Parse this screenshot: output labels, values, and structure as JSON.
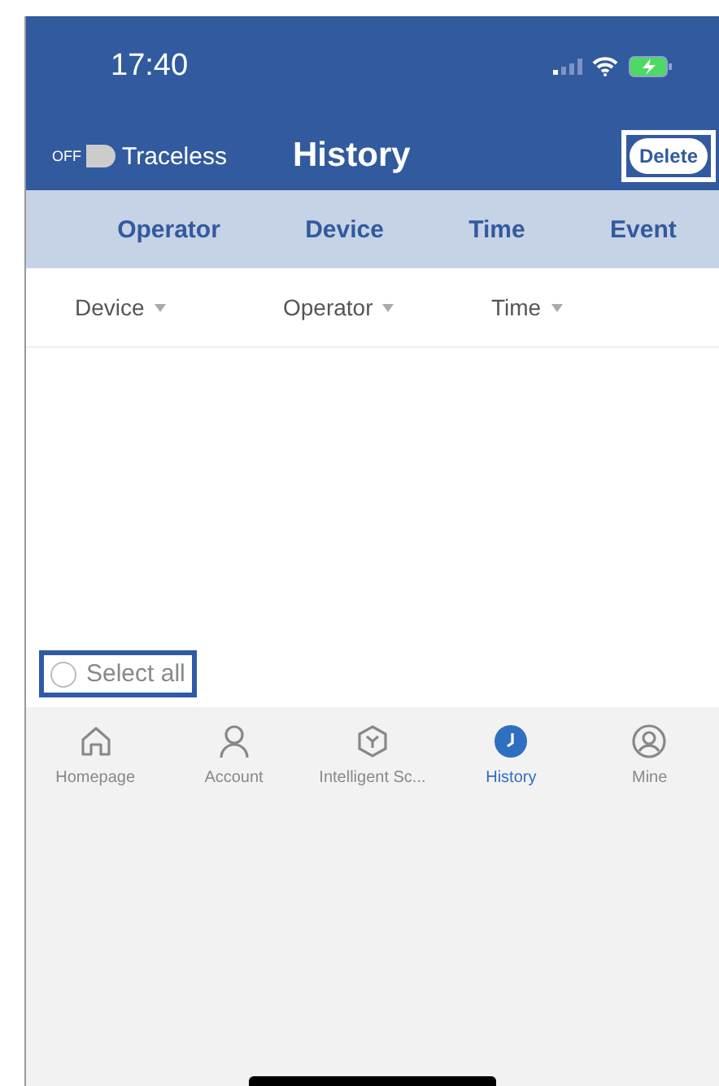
{
  "status_bar": {
    "time": "17:40"
  },
  "header": {
    "toggle": {
      "label": "OFF",
      "on": false
    },
    "toggle_caption": "Traceless",
    "title": "History",
    "delete_button": "Delete"
  },
  "tabs": [
    "Operator",
    "Device",
    "Time",
    "Event"
  ],
  "filters": [
    "Device",
    "Operator",
    "Time"
  ],
  "select_all": {
    "label": "Select all",
    "checked": false
  },
  "bottom_nav": [
    {
      "label": "Homepage",
      "kind": "home",
      "selected": false
    },
    {
      "label": "Account",
      "kind": "person",
      "selected": false
    },
    {
      "label": "Intelligent Sc...",
      "kind": "hexagon",
      "selected": false
    },
    {
      "label": "History",
      "kind": "clock",
      "selected": true
    },
    {
      "label": "Mine",
      "kind": "profile",
      "selected": false
    }
  ]
}
